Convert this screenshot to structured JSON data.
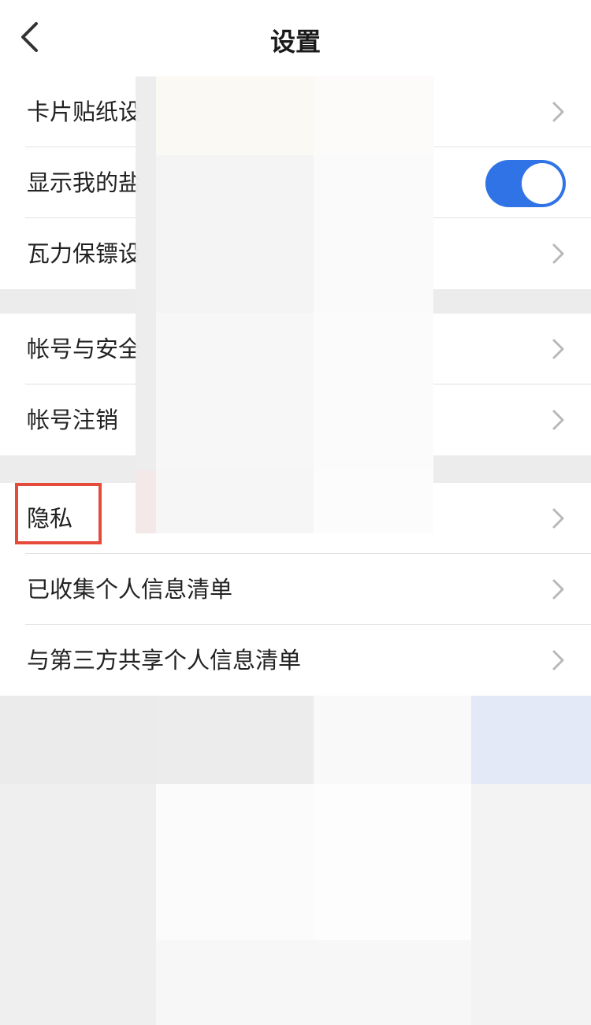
{
  "header": {
    "title": "设置",
    "back_icon": "chevron-left-icon"
  },
  "sections": [
    {
      "items": [
        {
          "label": "卡片贴纸设",
          "control": "chevron"
        },
        {
          "label": "显示我的盐",
          "control": "toggle",
          "toggle_on": true
        },
        {
          "label": "瓦力保镖设",
          "control": "chevron"
        }
      ]
    },
    {
      "items": [
        {
          "label": "帐号与安全",
          "control": "chevron"
        },
        {
          "label": "帐号注销",
          "control": "chevron"
        }
      ]
    },
    {
      "items": [
        {
          "label": "隐私",
          "control": "chevron",
          "highlighted": true
        },
        {
          "label": "已收集个人信息清单",
          "control": "chevron"
        },
        {
          "label": "与第三方共享个人信息清单",
          "control": "chevron"
        }
      ]
    }
  ],
  "colors": {
    "toggle_on": "#2f73e6",
    "highlight": "#e44b3a",
    "chevron": "#b8b8b8"
  }
}
